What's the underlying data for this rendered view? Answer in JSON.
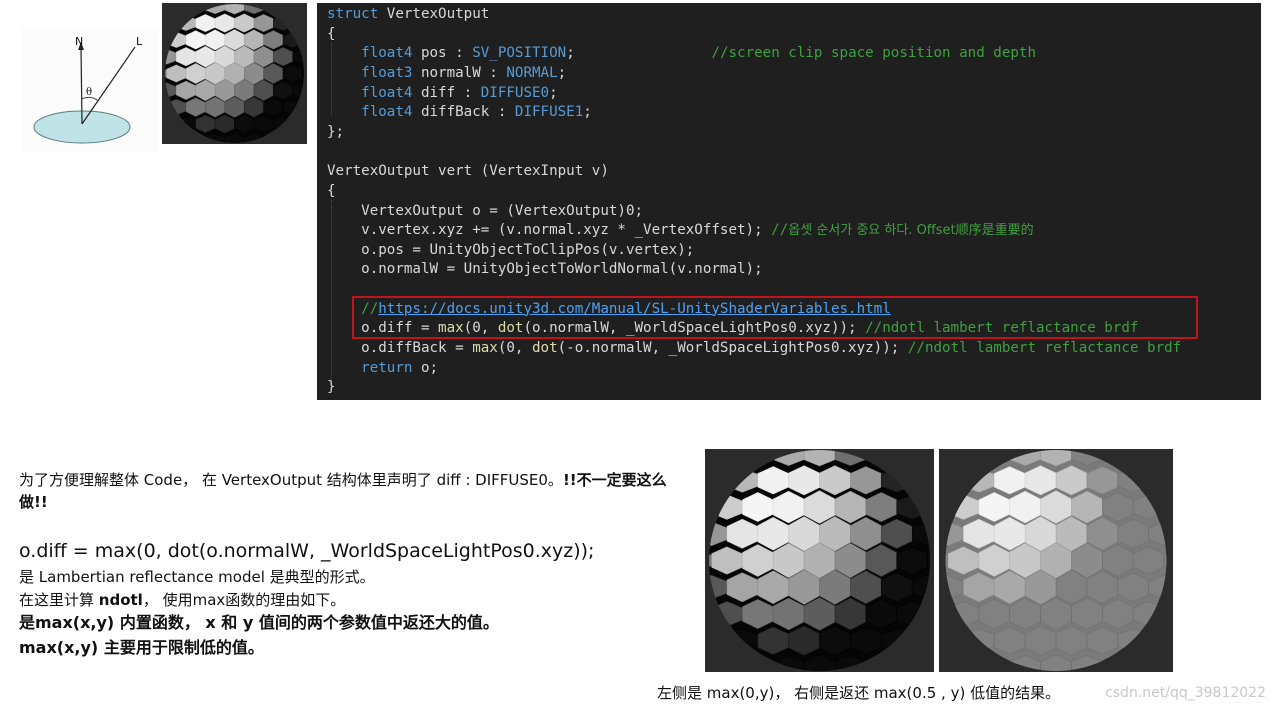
{
  "diagram": {
    "normal_label": "N",
    "light_label": "L",
    "angle_label": "θ"
  },
  "code": {
    "lines": [
      {
        "parts": [
          [
            "kw",
            "struct"
          ],
          [
            "",
            " VertexOutput"
          ]
        ]
      },
      {
        "parts": [
          [
            "",
            "{"
          ]
        ]
      },
      {
        "parts": [
          [
            "",
            "    "
          ],
          [
            "kw",
            "float4"
          ],
          [
            "",
            " pos : "
          ],
          [
            "sem",
            "SV_POSITION"
          ],
          [
            "",
            ";                "
          ],
          [
            "cm",
            "//screen clip space position and depth"
          ]
        ]
      },
      {
        "parts": [
          [
            "",
            "    "
          ],
          [
            "kw",
            "float3"
          ],
          [
            "",
            " normalW : "
          ],
          [
            "sem",
            "NORMAL"
          ],
          [
            "",
            ";"
          ]
        ]
      },
      {
        "parts": [
          [
            "",
            "    "
          ],
          [
            "kw",
            "float4"
          ],
          [
            "",
            " diff : "
          ],
          [
            "sem",
            "DIFFUSE0"
          ],
          [
            "",
            ";"
          ]
        ]
      },
      {
        "parts": [
          [
            "",
            "    "
          ],
          [
            "kw",
            "float4"
          ],
          [
            "",
            " diffBack : "
          ],
          [
            "sem",
            "DIFFUSE1"
          ],
          [
            "",
            ";"
          ]
        ]
      },
      {
        "parts": [
          [
            "",
            "};"
          ]
        ]
      },
      {
        "parts": [
          [
            "",
            ""
          ]
        ]
      },
      {
        "parts": [
          [
            "",
            "VertexOutput vert (VertexInput v)"
          ]
        ]
      },
      {
        "parts": [
          [
            "",
            "{"
          ]
        ]
      },
      {
        "parts": [
          [
            "",
            "    VertexOutput o = (VertexOutput)0;"
          ]
        ]
      },
      {
        "parts": [
          [
            "",
            "    v.vertex.xyz += (v.normal.xyz * _VertexOffset); "
          ],
          [
            "cm",
            "//"
          ],
          [
            "kr",
            "옵셋 순서가 중요 하다. Offset顺序是重要的"
          ]
        ]
      },
      {
        "parts": [
          [
            "",
            "    o.pos = UnityObjectToClipPos(v.vertex);"
          ]
        ]
      },
      {
        "parts": [
          [
            "",
            "    o.normalW = UnityObjectToWorldNormal(v.normal);"
          ]
        ]
      },
      {
        "parts": [
          [
            "",
            ""
          ]
        ]
      },
      {
        "parts": [
          [
            "",
            "    "
          ],
          [
            "cm",
            "//"
          ],
          [
            "cm-link",
            "https://docs.unity3d.com/Manual/SL-UnityShaderVariables.html"
          ]
        ]
      },
      {
        "parts": [
          [
            "",
            "    o.diff = "
          ],
          [
            "fn",
            "max"
          ],
          [
            "",
            "(0, "
          ],
          [
            "fn",
            "dot"
          ],
          [
            "",
            "(o.normalW, _WorldSpaceLightPos0.xyz)); "
          ],
          [
            "cm",
            "//ndotl lambert reflactance brdf"
          ]
        ]
      },
      {
        "parts": [
          [
            "",
            "    o.diffBack = "
          ],
          [
            "fn",
            "max"
          ],
          [
            "",
            "(0, "
          ],
          [
            "fn",
            "dot"
          ],
          [
            "",
            "(-o.normalW, _WorldSpaceLightPos0.xyz)); "
          ],
          [
            "cm",
            "//ndotl lambert reflactance brdf"
          ]
        ]
      },
      {
        "parts": [
          [
            "",
            "    "
          ],
          [
            "kw",
            "return"
          ],
          [
            "",
            " o;"
          ]
        ]
      },
      {
        "parts": [
          [
            "",
            "}"
          ]
        ]
      }
    ]
  },
  "text": {
    "intro_normal": "为了方便理解整体 Code， 在 VertexOutput 结构体里声明了 diff : DIFFUSE0。",
    "intro_bold": "!!不一定要这么做!!",
    "formula": "o.diff = max(0, dot(o.normalW, _WorldSpaceLightPos0.xyz));",
    "line1": "是 Lambertian reflectance model 是典型的形式。",
    "line2_a": "在这里计算 ",
    "line2_b": "ndotl",
    "line2_c": "， 使用max函数的理由如下。",
    "line3": "是max(x,y) 内置函数， x 和 y 值间的两个参数值中返还大的值。",
    "line4": "max(x,y) 主要用于限制低的值。"
  },
  "caption": "左侧是 max(0,y)， 右侧是返还 max(0.5 , y) 低值的结果。",
  "watermark": "csdn.net/qq_39812022",
  "spheres": [
    {
      "id": "top",
      "min_light": 0.0
    },
    {
      "id": "bottom-left",
      "min_light": 0.0
    },
    {
      "id": "bottom-right",
      "min_light": 0.5
    }
  ]
}
